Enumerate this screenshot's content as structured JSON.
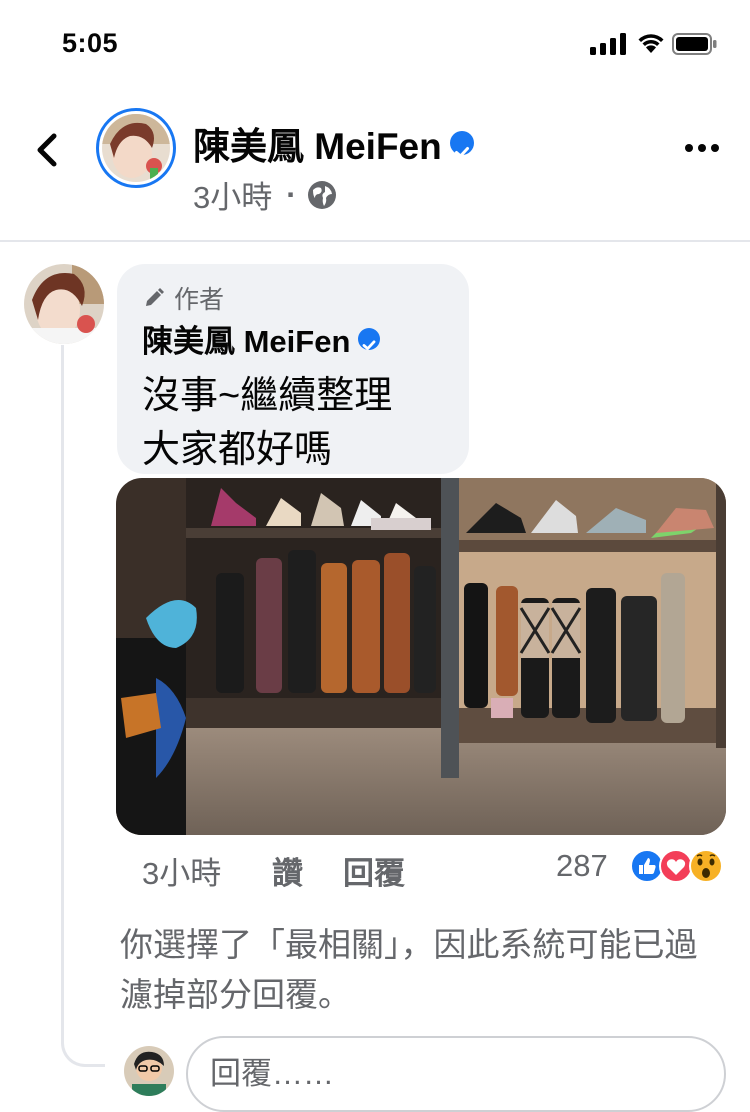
{
  "status_bar": {
    "time": "5:05"
  },
  "header": {
    "name": "陳美鳳 MeiFen",
    "time": "3小時",
    "separator": "·",
    "privacy_icon": "globe-icon",
    "back_icon": "chevron-left-icon",
    "more_icon": "more-horizontal-icon"
  },
  "comment": {
    "badge_label": "作者",
    "badge_icon": "pencil-icon",
    "author": "陳美鳳 MeiFen",
    "text_line1": "沒事~繼續整理",
    "text_line2": "大家都好嗎",
    "time": "3小時",
    "like_label": "讚",
    "reply_label": "回覆",
    "reaction_count": "287",
    "reactions": [
      "like",
      "love",
      "wow"
    ]
  },
  "notice": "你選擇了「最相關」，因此系統可能已過濾掉部分回覆。",
  "composer": {
    "placeholder": "回覆……"
  },
  "colors": {
    "accent": "#1877f2",
    "text_primary": "#050505",
    "text_secondary": "#65676b",
    "bubble_bg": "#f0f2f5",
    "love": "#f33e58",
    "wow": "#f7b125"
  }
}
